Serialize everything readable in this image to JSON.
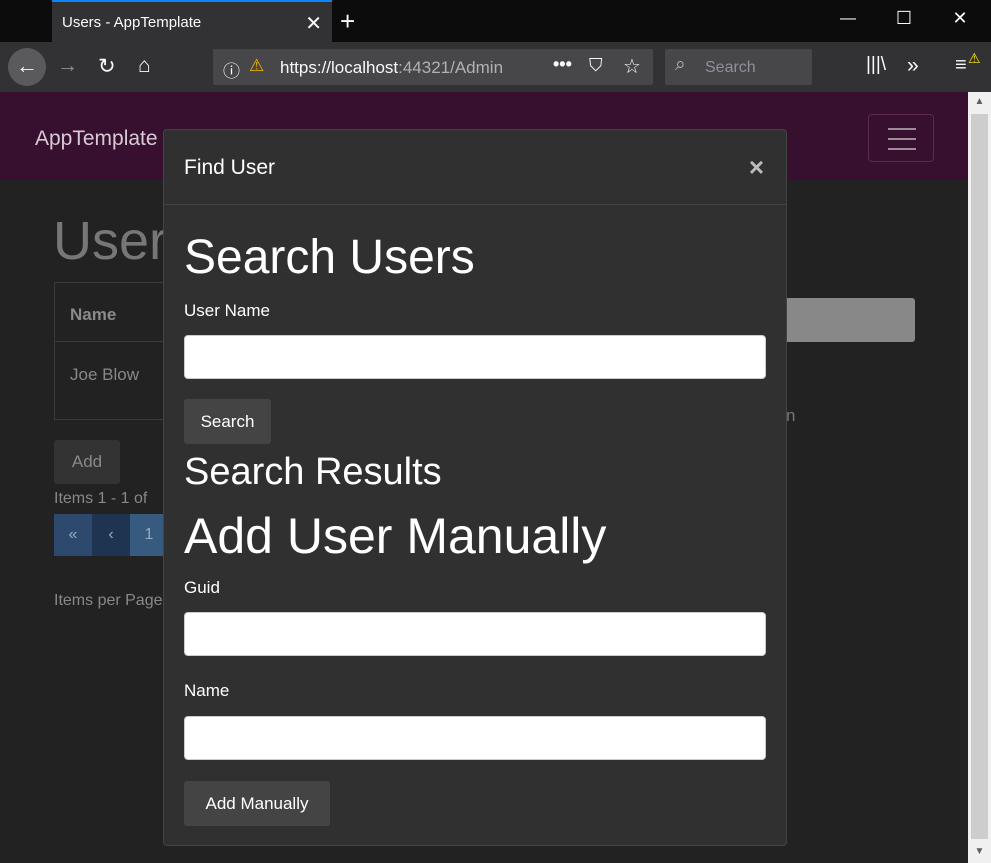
{
  "browser": {
    "tab_title": "Users - AppTemplate",
    "url_host": "https://localhost",
    "url_rest": ":44321/Admin",
    "search_placeholder": "Search"
  },
  "app": {
    "brand": "AppTemplate",
    "page_title": "Users",
    "table_header_name": "Name",
    "rows": [
      {
        "name": "Joe Blow"
      }
    ],
    "add_label": "Add",
    "items_text": "Items 1 - 1 of",
    "pager": [
      "«",
      "‹",
      "1"
    ],
    "per_page_text": "Items per Page"
  },
  "modal": {
    "title": "Find User",
    "close_glyph": "×",
    "search_heading": "Search Users",
    "user_name_label": "User Name",
    "user_name_value": "",
    "search_button": "Search",
    "results_heading": "Search Results",
    "manual_heading": "Add User Manually",
    "guid_label": "Guid",
    "guid_value": "",
    "name_label": "Name",
    "name_value": "",
    "add_manually_button": "Add Manually"
  },
  "colors": {
    "navbar": "#37102f",
    "modal_bg": "#303030",
    "accent": "#0a84ff"
  }
}
